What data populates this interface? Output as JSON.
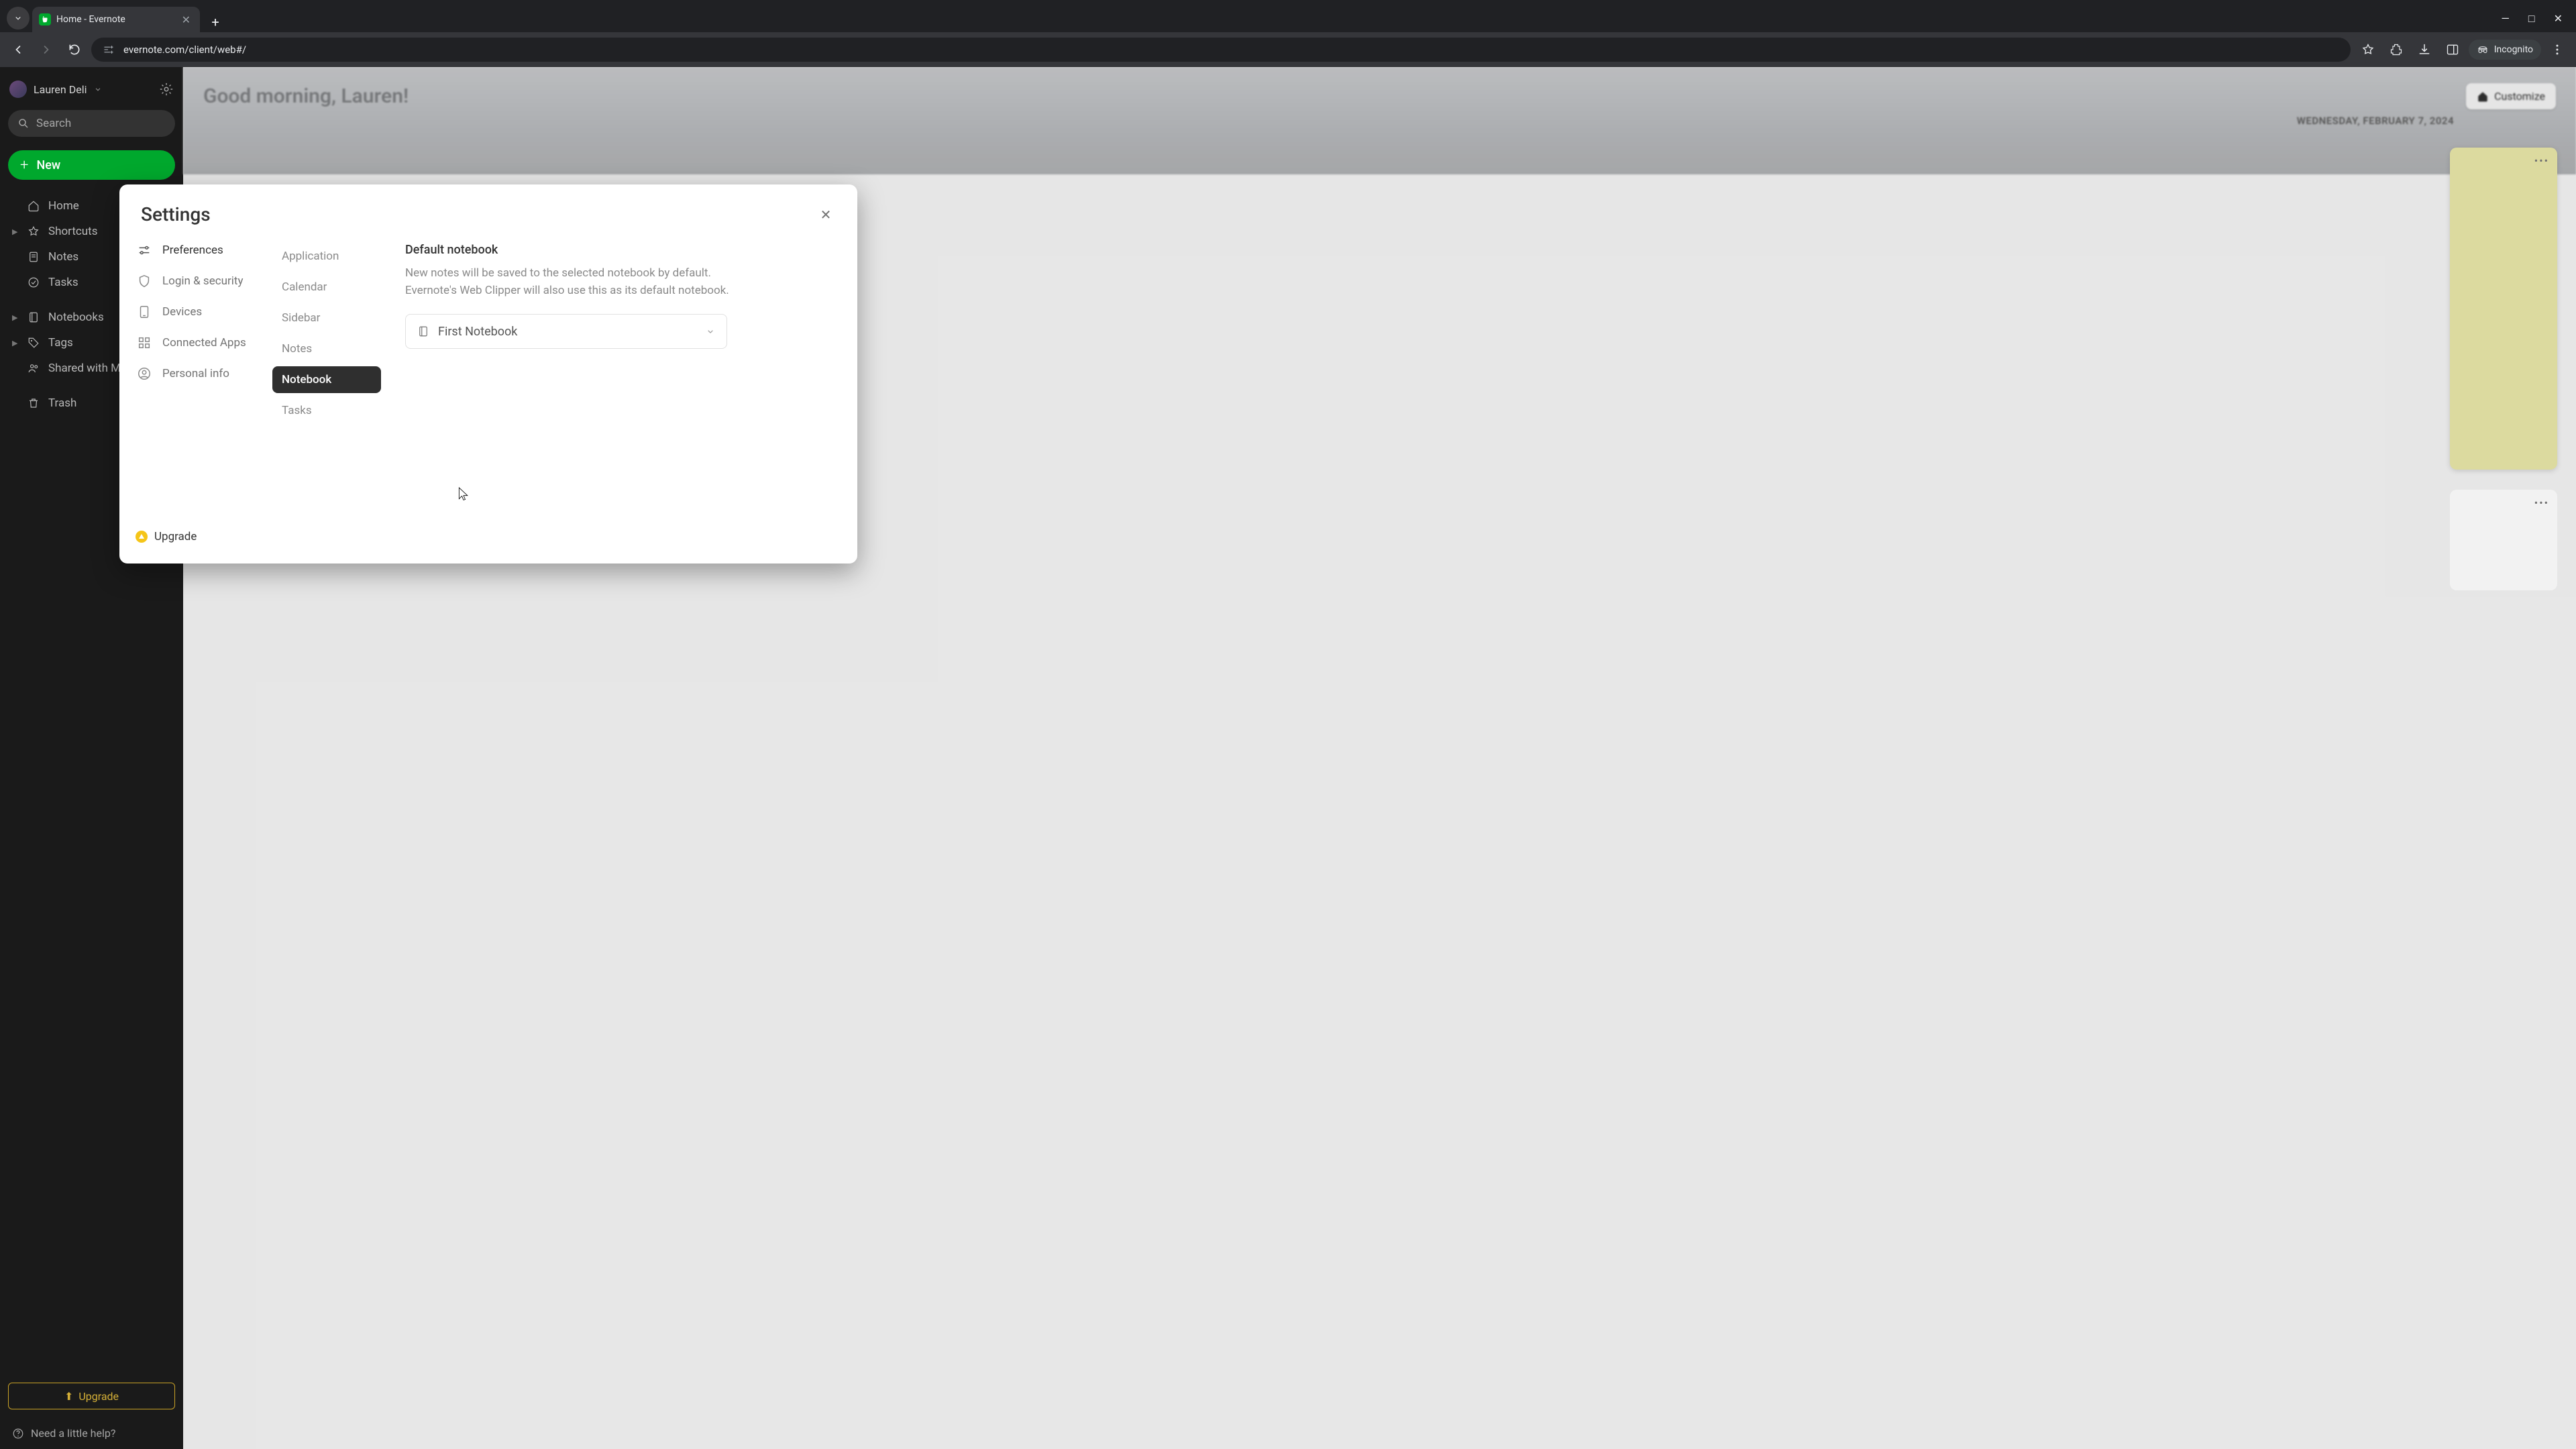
{
  "browser": {
    "tab_title": "Home - Evernote",
    "url": "evernote.com/client/web#/",
    "incognito_label": "Incognito"
  },
  "sidebar": {
    "username": "Lauren Deli",
    "search_placeholder": "Search",
    "new_label": "New",
    "items": [
      {
        "label": "Home"
      },
      {
        "label": "Shortcuts"
      },
      {
        "label": "Notes"
      },
      {
        "label": "Tasks"
      },
      {
        "label": "Notebooks"
      },
      {
        "label": "Tags"
      },
      {
        "label": "Shared with Me"
      },
      {
        "label": "Trash"
      }
    ],
    "upgrade_label": "Upgrade",
    "help_label": "Need a little help?"
  },
  "hero": {
    "greeting": "Good morning, Lauren!",
    "date": "WEDNESDAY, FEBRUARY 7, 2024",
    "customize_label": "Customize"
  },
  "modal": {
    "title": "Settings",
    "categories": [
      {
        "label": "Preferences"
      },
      {
        "label": "Login & security"
      },
      {
        "label": "Devices"
      },
      {
        "label": "Connected Apps"
      },
      {
        "label": "Personal info"
      }
    ],
    "upgrade_label": "Upgrade",
    "subtabs": [
      {
        "label": "Application"
      },
      {
        "label": "Calendar"
      },
      {
        "label": "Sidebar"
      },
      {
        "label": "Notes"
      },
      {
        "label": "Notebook"
      },
      {
        "label": "Tasks"
      }
    ],
    "pane": {
      "title": "Default notebook",
      "description": "New notes will be saved to the selected notebook by default. Evernote's Web Clipper will also use this as its default notebook.",
      "selected_notebook": "First Notebook"
    }
  }
}
